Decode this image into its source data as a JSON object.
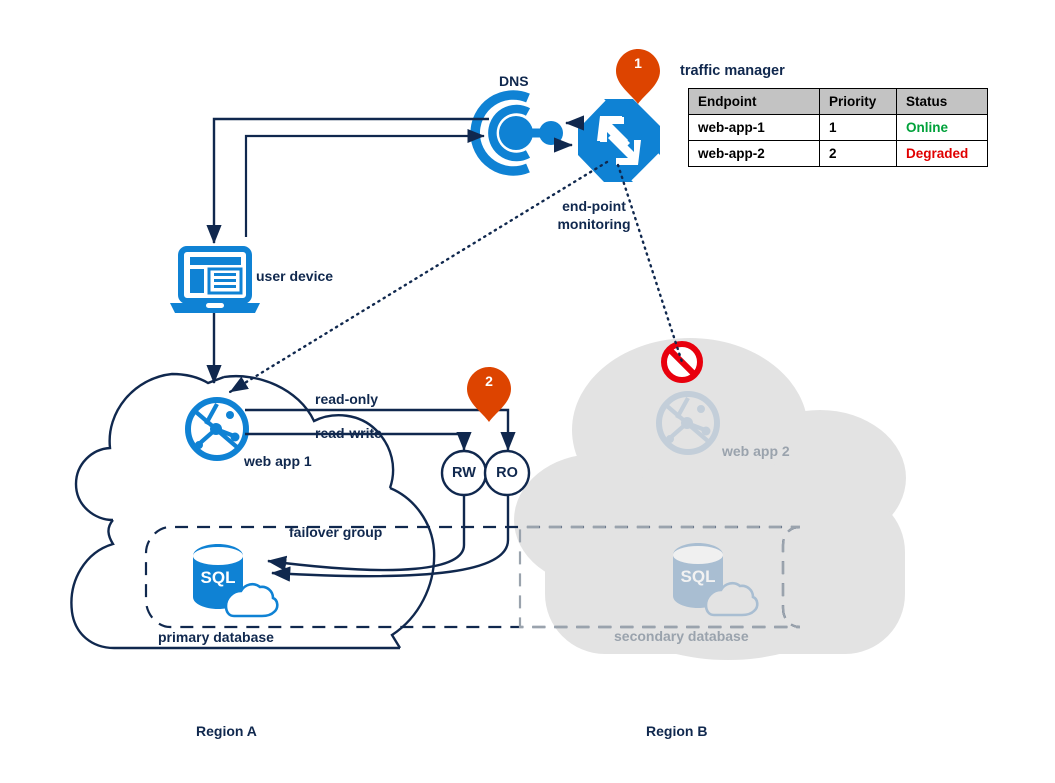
{
  "diagram": {
    "title_traffic_manager": "traffic manager",
    "regions": [
      {
        "name": "region-a",
        "label": "Region A"
      },
      {
        "name": "region-b",
        "label": "Region B"
      }
    ],
    "nodes": {
      "dns": {
        "label": "DNS",
        "icon": "dns-icon"
      },
      "traffic_manager": {
        "icon": "traffic-manager-icon",
        "badge": "1"
      },
      "user_device": {
        "label": "user device",
        "icon": "laptop-icon"
      },
      "web_app_1": {
        "label": "web app 1",
        "icon": "web-app-icon"
      },
      "web_app_2": {
        "label": "web app 2",
        "icon": "web-app-icon-disabled"
      },
      "primary_database": {
        "label": "primary database",
        "icon": "sql-database-icon",
        "caption": "SQL"
      },
      "secondary_database": {
        "label": "secondary database",
        "icon": "sql-database-icon-disabled",
        "caption": "SQL"
      },
      "rw_listener": {
        "label": "RW",
        "badge": "2"
      },
      "ro_listener": {
        "label": "RO"
      },
      "blocked_marker": {
        "icon": "no-entry-icon"
      }
    },
    "edges": {
      "read_only": "read-only",
      "read_write": "read-write",
      "end_point_monitoring_line1": "end-point",
      "end_point_monitoring_line2": "monitoring",
      "failover_group": "failover group"
    },
    "table": {
      "headers": [
        "Endpoint",
        "Priority",
        "Status"
      ],
      "rows": [
        {
          "endpoint": "web-app-1",
          "priority": "1",
          "status": "Online",
          "status_state": "online"
        },
        {
          "endpoint": "web-app-2",
          "priority": "2",
          "status": "Degraded",
          "status_state": "degraded"
        }
      ]
    },
    "colors": {
      "azure_blue": "#0f82d4",
      "navy": "#10284e",
      "orange_badge": "#dd4400",
      "red_block": "#e8000d",
      "grey_region": "#e3e3e3",
      "grey_text": "#9aa3ad",
      "status_online": "#00a13a",
      "status_degraded": "#e00000",
      "table_header_bg": "#c3c3c3"
    }
  }
}
